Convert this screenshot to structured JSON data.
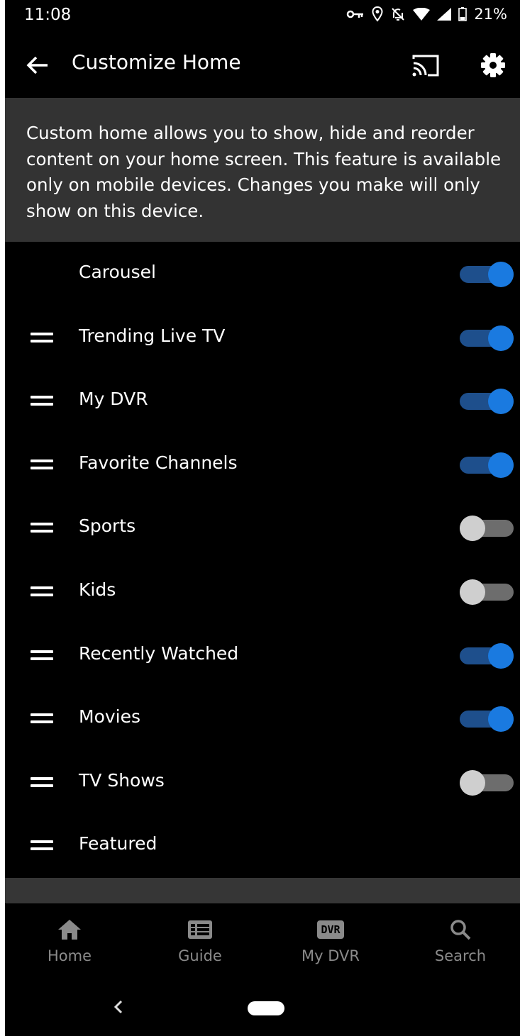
{
  "status": {
    "time": "11:08",
    "battery": "21%"
  },
  "appbar": {
    "title": "Customize Home"
  },
  "info": {
    "text": "Custom home allows you to show, hide and reorder content on your home screen. This feature is available only on mobile devices. Changes you make will only show on this device."
  },
  "rows": [
    {
      "label": "Carousel",
      "toggle": true,
      "draggable": false,
      "has_toggle": true
    },
    {
      "label": "Trending Live TV",
      "toggle": true,
      "draggable": true,
      "has_toggle": true
    },
    {
      "label": "My DVR",
      "toggle": true,
      "draggable": true,
      "has_toggle": true
    },
    {
      "label": "Favorite Channels",
      "toggle": true,
      "draggable": true,
      "has_toggle": true
    },
    {
      "label": "Sports",
      "toggle": false,
      "draggable": true,
      "has_toggle": true
    },
    {
      "label": "Kids",
      "toggle": false,
      "draggable": true,
      "has_toggle": true
    },
    {
      "label": "Recently Watched",
      "toggle": true,
      "draggable": true,
      "has_toggle": true
    },
    {
      "label": "Movies",
      "toggle": true,
      "draggable": true,
      "has_toggle": true
    },
    {
      "label": "TV Shows",
      "toggle": false,
      "draggable": true,
      "has_toggle": true
    },
    {
      "label": "Featured",
      "toggle": false,
      "draggable": true,
      "has_toggle": false
    }
  ],
  "nav": {
    "home": "Home",
    "guide": "Guide",
    "dvr": "My DVR",
    "dvr_badge": "DVR",
    "search": "Search"
  },
  "colors": {
    "toggle_on": "#1a7ae0",
    "toggle_track_on": "#1e4f8c",
    "banner": "#333333"
  }
}
